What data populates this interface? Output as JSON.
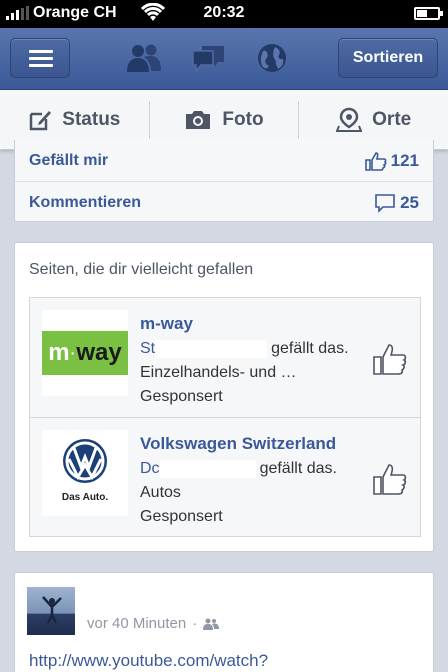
{
  "status_bar": {
    "carrier": "Orange CH",
    "time": "20:32"
  },
  "navbar": {
    "menu_icon": "hamburger-icon",
    "icons": [
      "friends-icon",
      "messages-icon",
      "globe-icon"
    ],
    "sort_label": "Sortieren"
  },
  "composer": {
    "items": [
      {
        "label": "Status",
        "icon": "edit-icon"
      },
      {
        "label": "Foto",
        "icon": "camera-icon"
      },
      {
        "label": "Orte",
        "icon": "map-pin-icon"
      }
    ]
  },
  "actions": {
    "like_label": "Gefällt mir",
    "like_count": "121",
    "comment_label": "Kommentieren",
    "comment_count": "25"
  },
  "suggestions": {
    "heading": "Seiten, die dir vielleicht gefallen",
    "pages": [
      {
        "name": "m-way",
        "logo_text": "m-way",
        "friend_prefix": "St",
        "likes_suffix": "gefällt das.",
        "category": "Einzelhandels- und …",
        "sponsored": "Gesponsert"
      },
      {
        "name": "Volkswagen Switzerland",
        "logo_text": "Das Auto.",
        "friend_prefix": "Dc",
        "likes_suffix": "gefällt das.",
        "category": "Autos",
        "sponsored": "Gesponsert"
      }
    ]
  },
  "post": {
    "time": "vor 40 Minuten",
    "separator": "·",
    "audience_icon": "friends-icon",
    "link": "http://www.youtube.com/watch?"
  },
  "colors": {
    "brand": "#3b5998",
    "mway_green": "#7ac143",
    "vw_blue": "#1b3f78"
  }
}
